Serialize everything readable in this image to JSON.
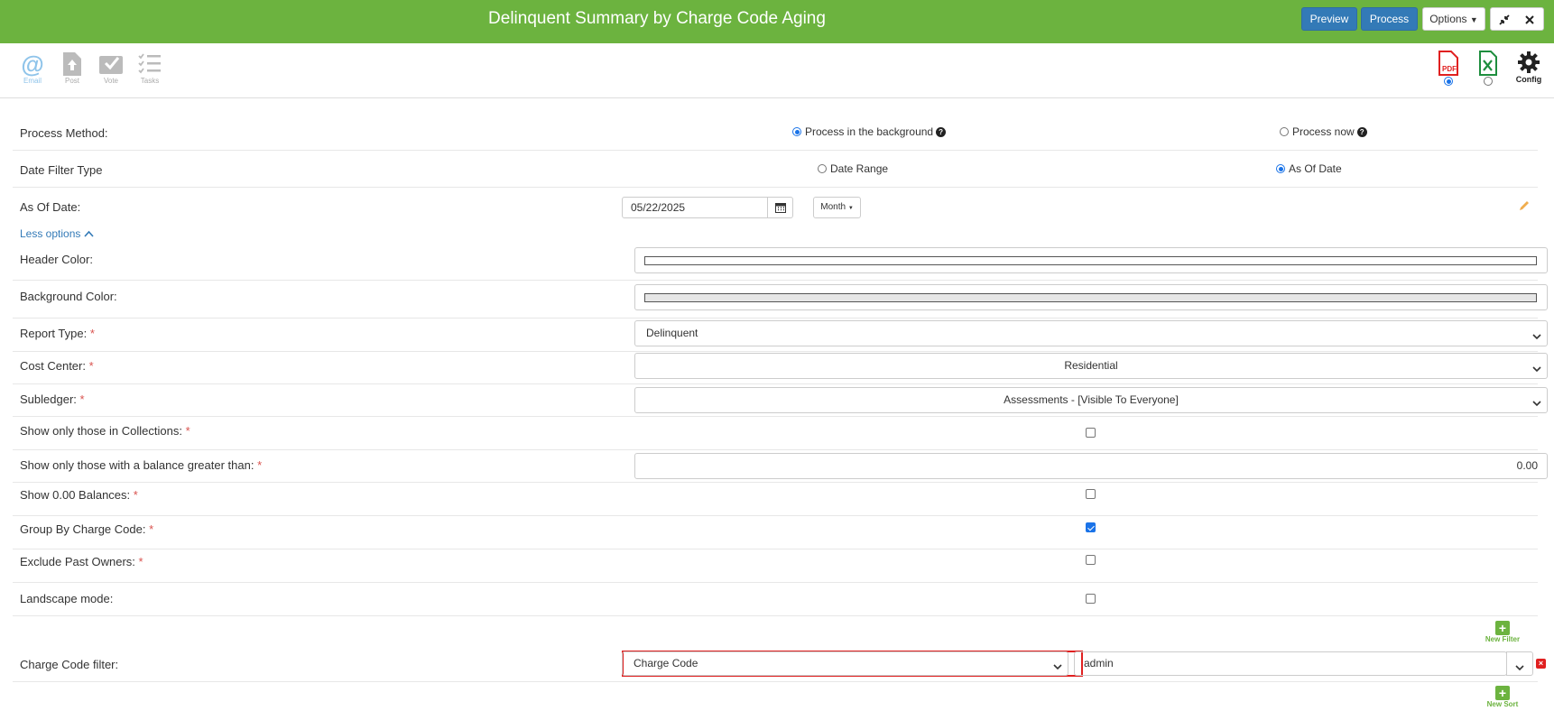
{
  "header": {
    "title": "Delinquent Summary by Charge Code Aging",
    "preview_label": "Preview",
    "process_label": "Process",
    "options_label": "Options",
    "bg_color": "#6cb33f"
  },
  "toolbar": {
    "email_label": "Email",
    "post_label": "Post",
    "vote_label": "Vote",
    "tasks_label": "Tasks",
    "pdf_text": "PDF",
    "config_label": "Config",
    "selected_format": "pdf"
  },
  "form": {
    "process_method": {
      "label": "Process Method:",
      "option_background": "Process in the background",
      "option_now": "Process now",
      "selected": "background"
    },
    "date_filter_type": {
      "label": "Date Filter Type",
      "option_range": "Date Range",
      "option_asof": "As Of Date",
      "selected": "asof"
    },
    "as_of_date": {
      "label": "As Of Date:",
      "value": "05/22/2025",
      "period": "Month"
    },
    "less_options": "Less options",
    "header_color": {
      "label": "Header Color:",
      "value": "#ffffff"
    },
    "background_color": {
      "label": "Background Color:",
      "value": "#e6e6e6"
    },
    "report_type": {
      "label": "Report Type:",
      "value": "Delinquent"
    },
    "cost_center": {
      "label": "Cost Center:",
      "value": "Residential"
    },
    "subledger": {
      "label": "Subledger:",
      "value": "Assessments - [Visible To Everyone]"
    },
    "collections": {
      "label": "Show only those in Collections:",
      "checked": false
    },
    "balance_greater": {
      "label": "Show only those with a balance greater than:",
      "value": "0.00"
    },
    "zero_balances": {
      "label": "Show 0.00 Balances:",
      "checked": false
    },
    "group_by_charge_code": {
      "label": "Group By Charge Code:",
      "checked": true
    },
    "exclude_past_owners": {
      "label": "Exclude Past Owners:",
      "checked": false
    },
    "landscape_mode": {
      "label": "Landscape mode:",
      "checked": false
    },
    "required_mark": "*",
    "charge_code_filter": {
      "label": "Charge Code filter:",
      "field": "Charge Code",
      "value": "admin",
      "new_filter_label": "New Filter",
      "new_sort_label": "New Sort"
    }
  }
}
